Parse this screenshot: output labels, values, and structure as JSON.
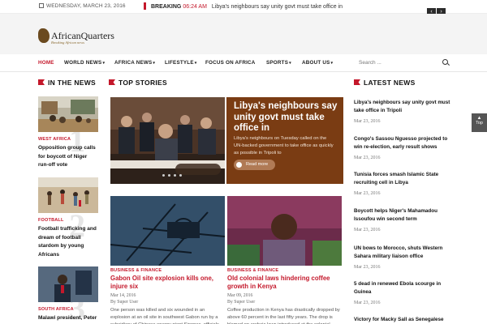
{
  "topbar": {
    "date": "WEDNESDAY, MARCH 23, 2016",
    "breaking_label": "BREAKING",
    "breaking_time": "06:24 AM",
    "breaking_headline": "Libya's neighbours say unity govt must take office in",
    "prev_label": "‹",
    "next_label": "›"
  },
  "header": {
    "logo_name": "AfricanQuarters",
    "logo_tagline": "Breaking African news"
  },
  "nav": {
    "items": [
      "HOME",
      "WORLD NEWS",
      "AFRICA NEWS",
      "LIFESTYLE",
      "FOCUS ON AFRICA",
      "SPORTS",
      "ABOUT US"
    ],
    "search_placeholder": "Search ..."
  },
  "sections": {
    "in_the_news": "IN THE NEWS",
    "top_stories": "TOP STORIES",
    "latest_news": "LATEST NEWS"
  },
  "in_the_news": [
    {
      "number": "1",
      "category": "WEST AFRICA",
      "title": "Opposition group calls for boycott of Niger run-off vote"
    },
    {
      "number": "2",
      "category": "FOOTBALL",
      "title": "Football trafficking and dream of football stardom by young Africans"
    },
    {
      "number": "3",
      "category": "SOUTH AFRICA",
      "title": "Malawi president, Peter"
    }
  ],
  "hero": {
    "title": "Libya's neighbours say unity govt must take office in",
    "description": "Libya's neighbours on Tuesday called on the UN-backed government to take office as quickly as possible in Tripoli to",
    "read_more": "Read more"
  },
  "stories": [
    {
      "category": "BUSINESS & FINANCE",
      "title": "Gabon Oil site explosion kills one, injure six",
      "date": "Mar 14, 2016",
      "author": "By Super User",
      "excerpt": "One person was killed and six wounded in an explosion at an oil site in southwest Gabon run by a subsidiary of Chinese energy giant Sinopec, officials"
    },
    {
      "category": "BUSINESS & FINANCE",
      "title": "Old colonial laws hindering coffee growth in Kenya",
      "date": "Mar 09, 2016",
      "author": "By Super User",
      "excerpt": "Coffee production in Kenya has drastically dropped by above 60 percent in the last fifty years. The drop is blamed on archaic laws introduced at the colonial"
    }
  ],
  "latest": [
    {
      "title": "Libya's neighbours say unity govt must take office in Tripoli",
      "date": "Mar 23, 2016"
    },
    {
      "title": "Congo's Sassou Nguesso projected to win re-election, early result shows",
      "date": "Mar 23, 2016"
    },
    {
      "title": "Tunisia forces smash Islamic State recruiting cell in Libya",
      "date": "Mar 23, 2016"
    },
    {
      "title": "Boycott helps Niger's Mahamadou Issoufou win second term",
      "date": "Mar 23, 2016"
    },
    {
      "title": "UN bows to Morocco, shuts Western Sahara military liaison office",
      "date": "Mar 23, 2016"
    },
    {
      "title": "5 dead in renewed Ebola scourge in Guinea",
      "date": "Mar 23, 2016"
    },
    {
      "title": "Victory for Macky Sall as Senegalese"
    }
  ],
  "to_top_label": "Top",
  "colors": {
    "accent": "#c4182b",
    "hero_bg": "#7a3c13"
  }
}
